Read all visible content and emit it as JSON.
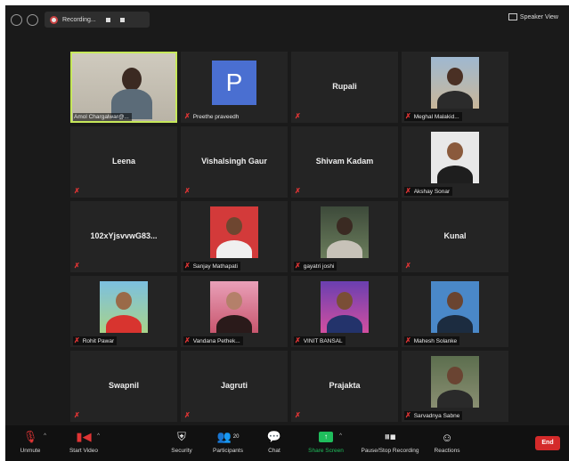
{
  "topbar": {
    "recording_label": "Recording...",
    "speaker_view_label": "Speaker View"
  },
  "participants": [
    {
      "name": "Amol Chargalwar@...",
      "kind": "video"
    },
    {
      "name": "Preethe praveedh",
      "kind": "letter",
      "letter": "P"
    },
    {
      "name": "Rupali",
      "kind": "name"
    },
    {
      "name": "Meghal Malakid...",
      "kind": "photo"
    },
    {
      "name": "Leena",
      "kind": "name"
    },
    {
      "name": "Vishalsingh Gaur",
      "kind": "name"
    },
    {
      "name": "Shivam Kadam",
      "kind": "name"
    },
    {
      "name": "Akshay Sonar",
      "kind": "photo"
    },
    {
      "name": "102xYjsvvwG83...",
      "kind": "name"
    },
    {
      "name": "Sanjay Mathapati",
      "kind": "photo"
    },
    {
      "name": "gayatri joshi",
      "kind": "photo"
    },
    {
      "name": "Kunal",
      "kind": "name"
    },
    {
      "name": "Rohit Pawar",
      "kind": "photo"
    },
    {
      "name": "Vandana Pethek...",
      "kind": "photo"
    },
    {
      "name": "VINIT BANSAL",
      "kind": "photo"
    },
    {
      "name": "Mahesh Solanke",
      "kind": "photo"
    },
    {
      "name": "Swapnil",
      "kind": "name"
    },
    {
      "name": "Jagruti",
      "kind": "name"
    },
    {
      "name": "Prajakta",
      "kind": "name"
    },
    {
      "name": "Sarvadnya Sabne",
      "kind": "photo"
    }
  ],
  "toolbar": {
    "unmute": "Unmute",
    "start_video": "Start Video",
    "security": "Security",
    "participants": "Participants",
    "participants_count": "20",
    "chat": "Chat",
    "share_screen": "Share Screen",
    "pause_stop_recording": "Pause/Stop Recording",
    "reactions": "Reactions",
    "end": "End"
  },
  "colors": {
    "active_speaker_border": "#c6e85a",
    "share_green": "#1fbd5c",
    "end_red": "#d42a2a",
    "muted_red": "#e03434",
    "letter_avatar": "#4a6fd1"
  }
}
